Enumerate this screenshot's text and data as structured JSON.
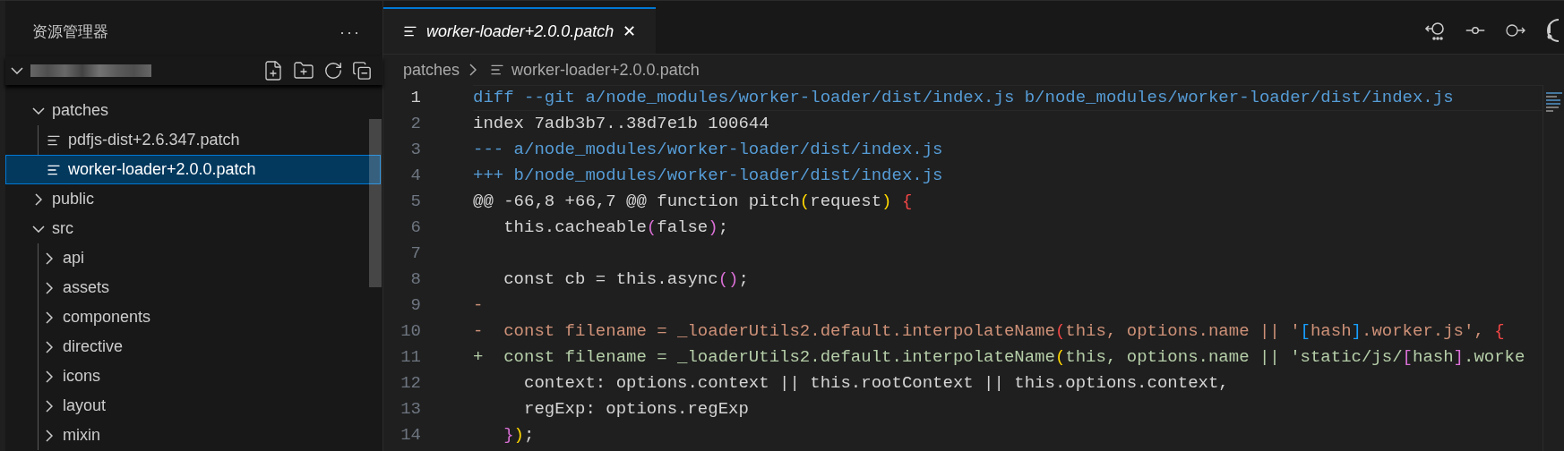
{
  "sidebar": {
    "title": "资源管理器",
    "more": "···",
    "tree": [
      {
        "kind": "folder",
        "name": "patches",
        "expanded": true,
        "selected": false,
        "children": [
          {
            "kind": "file",
            "name": "pdfjs-dist+2.6.347.patch",
            "selected": false
          },
          {
            "kind": "file",
            "name": "worker-loader+2.0.0.patch",
            "selected": true
          }
        ]
      },
      {
        "kind": "folder",
        "name": "public",
        "expanded": false,
        "selected": false
      },
      {
        "kind": "folder",
        "name": "src",
        "expanded": true,
        "selected": false,
        "children": [
          {
            "kind": "folder",
            "name": "api",
            "expanded": false,
            "selected": false
          },
          {
            "kind": "folder",
            "name": "assets",
            "expanded": false,
            "selected": false
          },
          {
            "kind": "folder",
            "name": "components",
            "expanded": false,
            "selected": false
          },
          {
            "kind": "folder",
            "name": "directive",
            "expanded": false,
            "selected": false
          },
          {
            "kind": "folder",
            "name": "icons",
            "expanded": false,
            "selected": false
          },
          {
            "kind": "folder",
            "name": "layout",
            "expanded": false,
            "selected": false
          },
          {
            "kind": "folder",
            "name": "mixin",
            "expanded": false,
            "selected": false
          }
        ]
      }
    ]
  },
  "tabs": [
    {
      "label": "worker-loader+2.0.0.patch",
      "selected": true,
      "close": "✕"
    }
  ],
  "breadcrumb": [
    "patches",
    "worker-loader+2.0.0.patch"
  ],
  "editor": {
    "lines": [
      {
        "number": "1",
        "current": true,
        "segments": [
          {
            "kind": "meta",
            "text": "diff --git a/node_modules/worker-loader/dist/index.js b/node_modules/worker-loader/dist/index.js"
          }
        ]
      },
      {
        "number": "2",
        "current": false,
        "segments": [
          {
            "kind": "plain",
            "text": "index 7adb3b7..38d7e1b 100644"
          }
        ]
      },
      {
        "number": "3",
        "current": false,
        "segments": [
          {
            "kind": "meta",
            "text": "--- a/node_modules/worker-loader/dist/index.js"
          }
        ]
      },
      {
        "number": "4",
        "current": false,
        "segments": [
          {
            "kind": "meta",
            "text": "+++ b/node_modules/worker-loader/dist/index.js"
          }
        ]
      },
      {
        "number": "5",
        "current": false,
        "segments": [
          {
            "kind": "plain",
            "text": "@@ -66,8 +66,7 @@ function pitch"
          },
          {
            "kind": "gold",
            "text": "("
          },
          {
            "kind": "plain",
            "text": "request"
          },
          {
            "kind": "gold",
            "text": ")"
          },
          {
            "kind": "red",
            "text": " {"
          }
        ]
      },
      {
        "number": "6",
        "current": false,
        "segments": [
          {
            "kind": "plain",
            "text": "   this.cacheable"
          },
          {
            "kind": "pink",
            "text": "("
          },
          {
            "kind": "plain",
            "text": "false"
          },
          {
            "kind": "pink",
            "text": ")"
          },
          {
            "kind": "plain",
            "text": ";"
          }
        ]
      },
      {
        "number": "7",
        "current": false
      },
      {
        "number": "8",
        "current": false,
        "segments": [
          {
            "kind": "plain",
            "text": "   const cb = this.async"
          },
          {
            "kind": "pink",
            "text": "()"
          },
          {
            "kind": "plain",
            "text": ";"
          }
        ]
      },
      {
        "number": "9",
        "current": false,
        "segments": [
          {
            "kind": "del",
            "text": "-"
          }
        ]
      },
      {
        "number": "10",
        "current": false,
        "segments": [
          {
            "kind": "del",
            "text": "-  const filename = _loaderUtils2.default.interpolateName"
          },
          {
            "kind": "red",
            "text": "("
          },
          {
            "kind": "del",
            "text": "this, options.name || '"
          },
          {
            "kind": "blue",
            "text": "["
          },
          {
            "kind": "del",
            "text": "hash"
          },
          {
            "kind": "blue",
            "text": "]"
          },
          {
            "kind": "del",
            "text": ".worker.js', "
          },
          {
            "kind": "red",
            "text": "{"
          }
        ]
      },
      {
        "number": "11",
        "current": false,
        "segments": [
          {
            "kind": "add",
            "text": "+  const filename = _loaderUtils2.default.interpolateName"
          },
          {
            "kind": "gold",
            "text": "("
          },
          {
            "kind": "add",
            "text": "this, options.name || 'static/js/"
          },
          {
            "kind": "pink",
            "text": "["
          },
          {
            "kind": "add",
            "text": "hash"
          },
          {
            "kind": "pink",
            "text": "]"
          },
          {
            "kind": "add",
            "text": ".worke"
          }
        ]
      },
      {
        "number": "12",
        "current": false,
        "segments": [
          {
            "kind": "plain",
            "text": "     context: options.context || this.rootContext || this.options.context,"
          }
        ]
      },
      {
        "number": "13",
        "current": false,
        "segments": [
          {
            "kind": "plain",
            "text": "     regExp: options.regExp"
          }
        ]
      },
      {
        "number": "14",
        "current": false,
        "segments": [
          {
            "kind": "pink",
            "text": "   }"
          },
          {
            "kind": "gold",
            "text": ")"
          },
          {
            "kind": "plain",
            "text": ";"
          }
        ]
      }
    ]
  }
}
